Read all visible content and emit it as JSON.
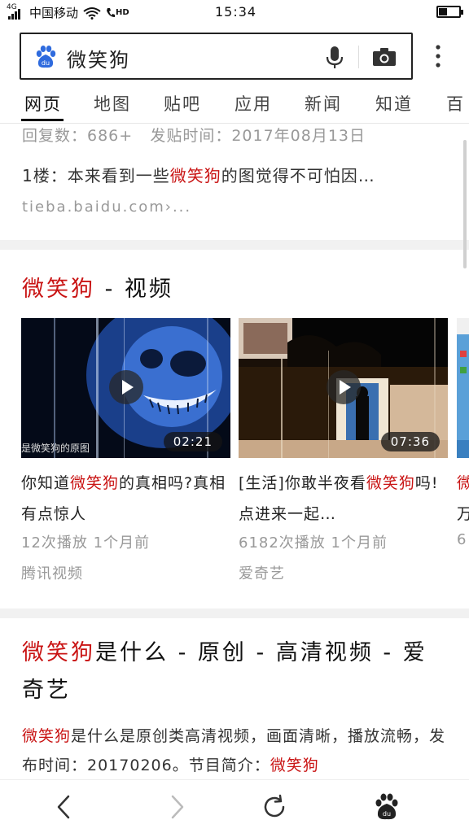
{
  "status": {
    "network_type": "4G",
    "carrier": "中国移动",
    "hd_label": "HD",
    "time": "15:34"
  },
  "search": {
    "query": "微笑狗",
    "logo_text": "du"
  },
  "tabs": [
    {
      "label": "网页",
      "active": true
    },
    {
      "label": "地图"
    },
    {
      "label": "贴吧"
    },
    {
      "label": "应用"
    },
    {
      "label": "新闻"
    },
    {
      "label": "知道"
    },
    {
      "label": "百"
    }
  ],
  "tieba_result": {
    "meta_prefix": "回复数：686+",
    "meta_time": "发贴时间：2017年08月13日",
    "floor_prefix": "1楼：本来看到一些",
    "floor_highlight": "微笑狗",
    "floor_suffix": "的图觉得不可怕因…",
    "url": "tieba.baidu.com›..."
  },
  "video_section": {
    "title_highlight": "微笑狗",
    "title_suffix": " - 视频",
    "cards": [
      {
        "title_pre": "你知道",
        "title_hl": "微笑狗",
        "title_post": "的真相吗?真相有点惊人",
        "duration": "02:21",
        "watermark": "是微笑狗的原图",
        "plays": "12次播放  1个月前",
        "source": "腾讯视频"
      },
      {
        "title_pre": "[生活]你敢半夜看",
        "title_hl": "微笑狗",
        "title_post": "吗!点进来一起…",
        "duration": "07:36",
        "plays": "6182次播放  1个月前",
        "source": "爱奇艺"
      },
      {
        "title_pre": "",
        "title_hl": "微",
        "title_post": "万",
        "plays": "6",
        "source": ""
      }
    ]
  },
  "web_result": {
    "title_hl": "微笑狗",
    "title_rest": "是什么 - 原创 - 高清视频 - 爱奇艺",
    "desc_hl1": "微笑狗",
    "desc_mid": "是什么是原创类高清视频，画面清晰，播放流畅，发布时间：20170206。节目简介：",
    "desc_hl2": "微笑狗"
  },
  "colors": {
    "highlight": "#c91414",
    "muted": "#999999",
    "baidu_blue": "#2f6bde"
  }
}
